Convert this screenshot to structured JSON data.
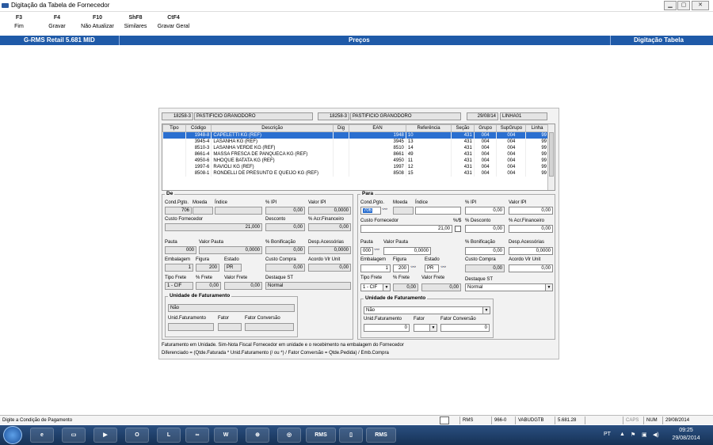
{
  "window": {
    "title": "Digitação da Tabela de Fornecedor"
  },
  "toolbar": [
    {
      "key": "F3",
      "label": "Fim"
    },
    {
      "key": "F4",
      "label": "Gravar"
    },
    {
      "key": "F10",
      "label": "Não Atualizar"
    },
    {
      "key": "ShF8",
      "label": "Similares"
    },
    {
      "key": "CtF4",
      "label": "Gravar Geral"
    }
  ],
  "header": {
    "left": "G-RMS Retail 5.681 MID",
    "center": "Preços",
    "right": "Digitação Tabela"
  },
  "top_fields": {
    "supplier1_code": "18258-3",
    "supplier1_name": "PASTIFICIO GRANODORO",
    "supplier2_code": "18258-3",
    "supplier2_name": "PASTIFICIO GRANODORO",
    "date": "29/08/14",
    "line": "LINHA01"
  },
  "grid": {
    "columns": [
      "Tipo",
      "Código",
      "Descrição",
      "Dig",
      "EAN",
      "Referência",
      "Seção",
      "Grupo",
      "SupGrupo",
      "Linha"
    ],
    "rows": [
      [
        "",
        "1948-8",
        "CAPELETTI KG (REF)",
        "",
        "1948",
        "10",
        "431",
        "004",
        "004",
        "99"
      ],
      [
        "",
        "3945-4",
        "LASANHA KG (REF)",
        "",
        "3945",
        "13",
        "431",
        "004",
        "004",
        "99"
      ],
      [
        "",
        "8510-3",
        "LASANHA VERDE KG (REF)",
        "",
        "8510",
        "14",
        "431",
        "004",
        "004",
        "99"
      ],
      [
        "",
        "8661-4",
        "MASSA FRESCA DE PANQUECA KG (REF)",
        "",
        "8661",
        "49",
        "431",
        "004",
        "004",
        "99"
      ],
      [
        "",
        "4950-6",
        "NHOQUE BATATA KG (REF)",
        "",
        "4950",
        "11",
        "431",
        "004",
        "004",
        "99"
      ],
      [
        "",
        "1997-6",
        "RAVIOLI KG (REF)",
        "",
        "1997",
        "12",
        "431",
        "004",
        "004",
        "99"
      ],
      [
        "",
        "8508-1",
        "RONDELLI DE PRESUNTO E QUEIJO KG (REF)",
        "",
        "8508",
        "15",
        "431",
        "004",
        "004",
        "99"
      ]
    ]
  },
  "de": {
    "title": "De",
    "l_cond": "Cond.Pgto.",
    "l_moeda": "Moeda",
    "l_indice": "Índice",
    "l_ipi": "% IPI",
    "l_vipi": "Valor IPI",
    "cond": "706",
    "ipi": "0,00",
    "vipi": "0,0000",
    "l_custo": "Custo Fornecedor",
    "l_desc": "Desconto",
    "l_acr": "% Acr.Financeiro",
    "custo": "21,000",
    "desc": "0,00",
    "acr": "0,00",
    "l_pauta": "Pauta",
    "l_vpauta": "Valor Pauta",
    "l_bonif": "% Bonificação",
    "l_desp": "Desp.Acessórias",
    "pauta": "000",
    "vpauta": "0,0000",
    "bonif": "0,00",
    "desp": "0,0000",
    "l_emb": "Embalagem",
    "l_fig": "Figura",
    "l_est": "Estado",
    "l_cc": "Custo Compra",
    "l_acordo": "Acordo Vlr Unit",
    "emb": "1",
    "fig": "200",
    "est": "PR",
    "cc": "0,00",
    "acordo": "0,00",
    "l_tf": "Tipo Frete",
    "l_pf": "% Frete",
    "l_vf": "Valor Frete",
    "l_dst": "Destaque ST",
    "tf": "1 - CIF",
    "pf": "0,00",
    "vf": "0,00",
    "dst": "Normal",
    "uf_title": "Unidade de Faturamento",
    "uf_val": "Não",
    "l_uf": "Unid.Faturamento",
    "l_fator": "Fator",
    "l_fc": "Fator Conversão"
  },
  "para": {
    "title": "Para",
    "l_cond": "Cond.Pgto.",
    "l_moeda": "Moeda",
    "l_indice": "Índice",
    "l_ipi": "% IPI",
    "l_vipi": "Valor IPI",
    "cond": "706",
    "ipi": "0,00",
    "vipi": "0,00",
    "l_custo": "Custo Fornecedor",
    "l_ds": "%/$",
    "l_desc": "% Desconto",
    "l_acr": "% Acr.Financeiro",
    "custo": "21,00",
    "desc": "0,00",
    "acr": "0,00",
    "l_pauta": "Pauta",
    "l_vpauta": "Valor Pauta",
    "l_bonif": "% Bonificação",
    "l_desp": "Desp.Acessórias",
    "pauta": "000",
    "vpauta": "0,0000",
    "bonif": "0,00",
    "desp": "0,0000",
    "l_emb": "Embalagem",
    "l_fig": "Figura",
    "l_est": "Estado",
    "l_cc": "Custo Compra",
    "l_acordo": "Acordo Vlr Unit",
    "emb": "1",
    "fig": "200",
    "est": "PR",
    "cc": "0,00",
    "acordo": "0,00",
    "l_tf": "Tipo Frete",
    "l_pf": "% Frete",
    "l_vf": "Valor Frete",
    "l_dst": "Destaque ST",
    "tf": "1 - CIF",
    "pf": "0,00",
    "vf": "0,00",
    "dst": "Normal",
    "uf_title": "Unidade de Faturamento",
    "uf_val": "Não",
    "l_uf": "Unid.Faturamento",
    "l_fator": "Fator",
    "l_fc": "Fator Conversão",
    "uf_num": "0",
    "fc": "0"
  },
  "notes": [
    "Faturamento em Unidade. Sim-Nota Fiscal Fornecedor em unidade e o recebimento na embalagem do Fornecedor",
    "Diferenciado = (Qtde.Faturada * Unid.Faturamento (/ ou *) / Fator Conversão  = Qtde.Pedida) / Emb.Compra"
  ],
  "statusbar": {
    "message": "Digite a Condição de Pagamento",
    "cells": [
      "RMS",
      "966-0",
      "VABUDGTB",
      "5.681.28",
      "",
      "CAPS",
      "NUM",
      "29/08/2014"
    ]
  },
  "taskbar": {
    "labels": [
      "RMS",
      "RMS"
    ],
    "lang": "PT",
    "time": "09:25",
    "date": "29/08/2014"
  }
}
